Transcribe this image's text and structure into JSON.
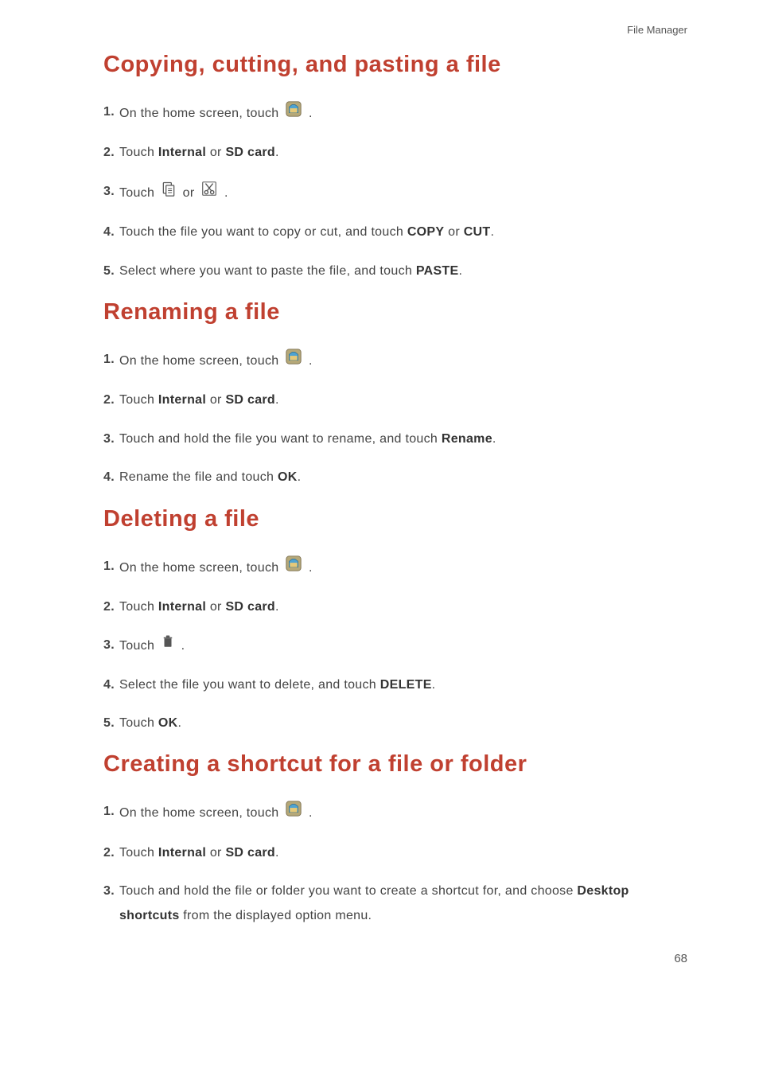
{
  "header": {
    "breadcrumb": "File Manager"
  },
  "sections": {
    "copy": {
      "heading": "Copying, cutting, and pasting a file",
      "s1a": "On the home screen, touch ",
      "s1b": ".",
      "s2a": "Touch ",
      "s2b": "Internal",
      "s2c": " or ",
      "s2d": "SD card",
      "s2e": ".",
      "s3a": "Touch ",
      "s3b": " or ",
      "s3c": ".",
      "s4a": "Touch the file you want to copy or cut, and touch ",
      "s4b": "COPY",
      "s4c": " or ",
      "s4d": "CUT",
      "s4e": ".",
      "s5a": "Select where you want to paste the file, and touch ",
      "s5b": "PASTE",
      "s5c": "."
    },
    "rename": {
      "heading": "Renaming a file",
      "s1a": "On the home screen, touch ",
      "s1b": ".",
      "s2a": "Touch ",
      "s2b": "Internal",
      "s2c": " or ",
      "s2d": "SD card",
      "s2e": ".",
      "s3a": "Touch and hold the file you want to rename, and touch ",
      "s3b": "Rename",
      "s3c": ".",
      "s4a": "Rename the file and touch ",
      "s4b": "OK",
      "s4c": "."
    },
    "delete": {
      "heading": "Deleting a file",
      "s1a": "On the home screen, touch ",
      "s1b": ".",
      "s2a": "Touch ",
      "s2b": "Internal",
      "s2c": " or ",
      "s2d": "SD card",
      "s2e": ".",
      "s3a": "Touch ",
      "s3b": ".",
      "s4a": "Select the file you want to delete, and touch ",
      "s4b": "DELETE",
      "s4c": ".",
      "s5a": "Touch ",
      "s5b": "OK",
      "s5c": "."
    },
    "shortcut": {
      "heading": "Creating a shortcut for a file or folder",
      "s1a": "On the home screen, touch ",
      "s1b": ".",
      "s2a": "Touch ",
      "s2b": "Internal",
      "s2c": " or ",
      "s2d": "SD card",
      "s2e": ".",
      "s3a": "Touch and hold the file or folder you want to create a shortcut for, and choose ",
      "s3b": "Desktop shortcuts",
      "s3c": " from the displayed option menu."
    }
  },
  "page_number": "68"
}
